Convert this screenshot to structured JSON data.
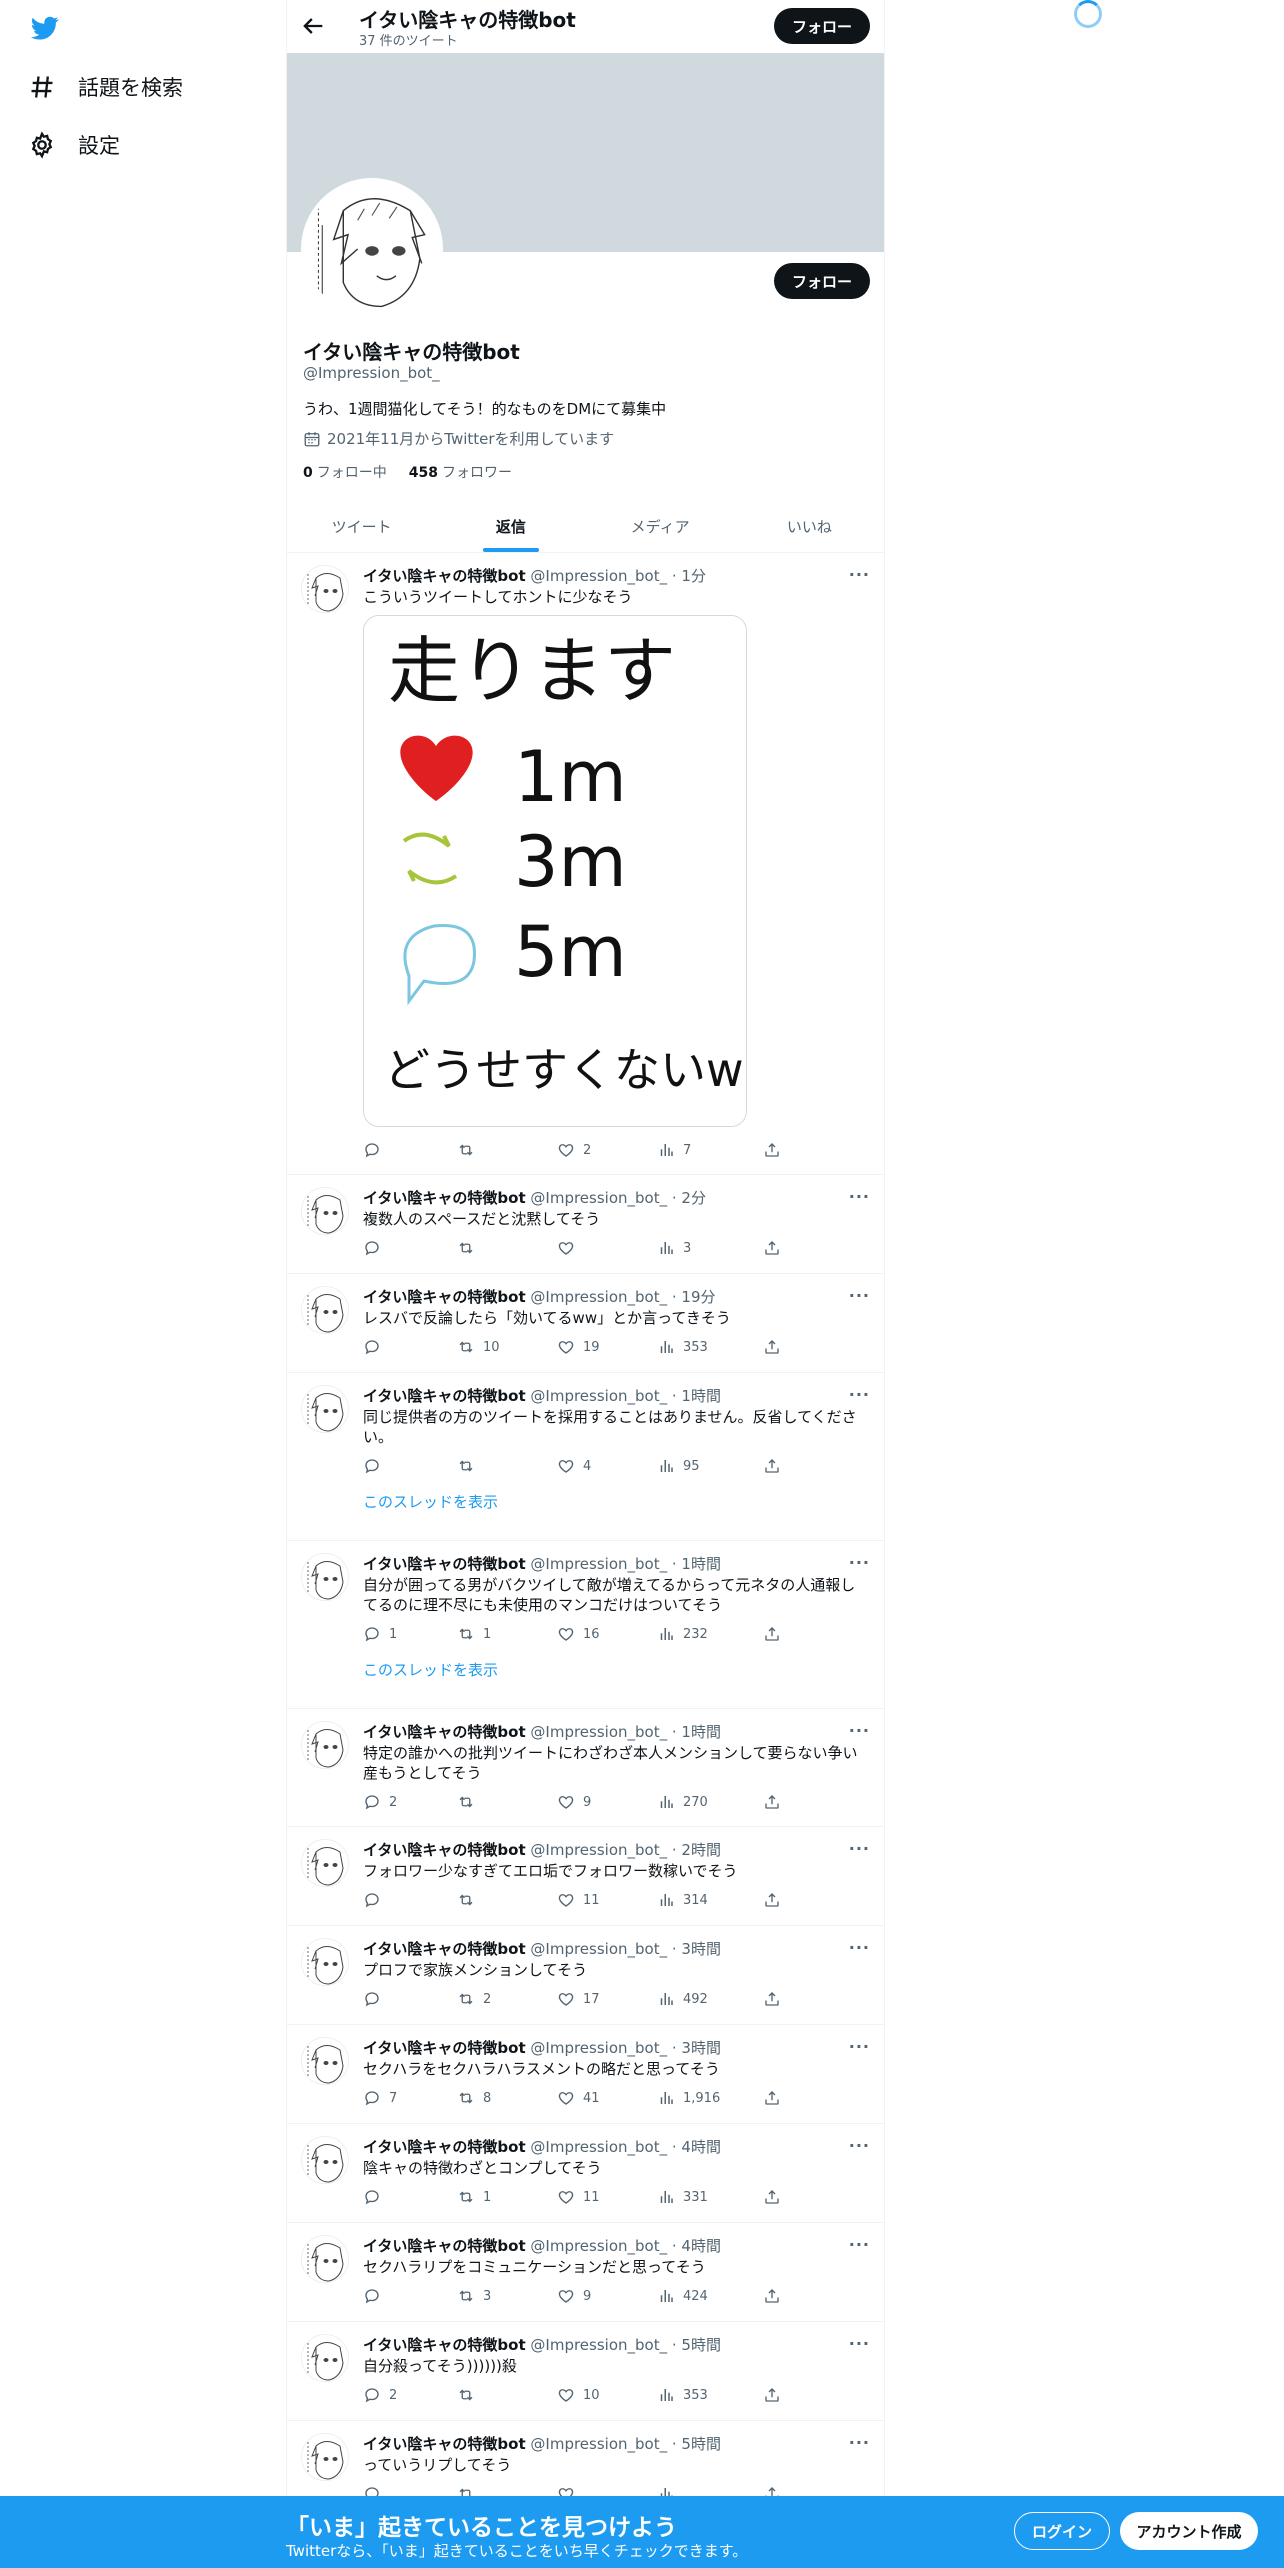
{
  "nav": {
    "explore": "話題を検索",
    "settings": "設定"
  },
  "header": {
    "title": "イタい陰キャの特徴bot",
    "tweet_count": "37 件のツイート",
    "follow": "フォロー"
  },
  "profile": {
    "name": "イタい陰キャの特徴bot",
    "handle": "@Impression_bot_",
    "bio": "うわ、1週間猫化してそう！的なものをDMにて募集中",
    "joined": "2021年11月からTwitterを利用しています",
    "following_count": "0",
    "following_label": "フォロー中",
    "followers_count": "458",
    "followers_label": "フォロワー",
    "follow": "フォロー"
  },
  "tabs": [
    "ツイート",
    "返信",
    "メディア",
    "いいね"
  ],
  "tweet_author": {
    "name": "イタい陰キャの特徴bot",
    "handle": "@Impression_bot_"
  },
  "thread_link": "このスレッドを表示",
  "image_text": {
    "line1": "走ります",
    "like": "1m",
    "retweet": "3m",
    "reply": "5m",
    "line5": "どうせすくないw"
  },
  "tweets": [
    {
      "time": "1分",
      "text": "こういうツイートしてホントに少なそう",
      "reply": "",
      "retweet": "",
      "like": "2",
      "views": "7"
    },
    {
      "time": "2分",
      "text": "複数人のスペースだと沈黙してそう",
      "reply": "",
      "retweet": "",
      "like": "",
      "views": "3"
    },
    {
      "time": "19分",
      "text": "レスバで反論したら「効いてるww」とか言ってきそう",
      "reply": "",
      "retweet": "10",
      "like": "19",
      "views": "353"
    },
    {
      "time": "1時間",
      "text": "同じ提供者の方のツイートを採用することはありません。反省してください。",
      "reply": "",
      "retweet": "",
      "like": "4",
      "views": "95"
    },
    {
      "time": "1時間",
      "text": "自分が囲ってる男がバクツイして敵が増えてるからって元ネタの人通報してるのに理不尽にも未使用のマンコだけはついてそう",
      "reply": "1",
      "retweet": "1",
      "like": "16",
      "views": "232"
    },
    {
      "time": "1時間",
      "text": "特定の誰かへの批判ツイートにわざわざ本人メンションして要らない争い産もうとしてそう",
      "reply": "2",
      "retweet": "",
      "like": "9",
      "views": "270"
    },
    {
      "time": "2時間",
      "text": "フォロワー少なすぎてエロ垢でフォロワー数稼いでそう",
      "reply": "",
      "retweet": "",
      "like": "11",
      "views": "314"
    },
    {
      "time": "3時間",
      "text": "プロフで家族メンションしてそう",
      "reply": "",
      "retweet": "2",
      "like": "17",
      "views": "492"
    },
    {
      "time": "3時間",
      "text": "セクハラをセクハラハラスメントの略だと思ってそう",
      "reply": "7",
      "retweet": "8",
      "like": "41",
      "views": "1,916"
    },
    {
      "time": "4時間",
      "text": "陰キャの特徴わざとコンプしてそう",
      "reply": "",
      "retweet": "1",
      "like": "11",
      "views": "331"
    },
    {
      "time": "4時間",
      "text": "セクハラリプをコミュニケーションだと思ってそう",
      "reply": "",
      "retweet": "3",
      "like": "9",
      "views": "424"
    },
    {
      "time": "5時間",
      "text": "自分殺ってそう))))))殺",
      "reply": "2",
      "retweet": "",
      "like": "10",
      "views": "353"
    },
    {
      "time": "5時間",
      "text": "っていうリプしてそう",
      "reply": "",
      "retweet": "",
      "like": "",
      "views": ""
    }
  ],
  "bottom": {
    "title": "「いま」起きていることを見つけよう",
    "subtitle": "Twitterなら、「いま」起きていることをいち早くチェックできます。",
    "login": "ログイン",
    "signup": "アカウント作成"
  },
  "colors": {
    "accent": "#1d9bf0",
    "banner": "#cfd9de",
    "text_secondary": "#536471"
  }
}
